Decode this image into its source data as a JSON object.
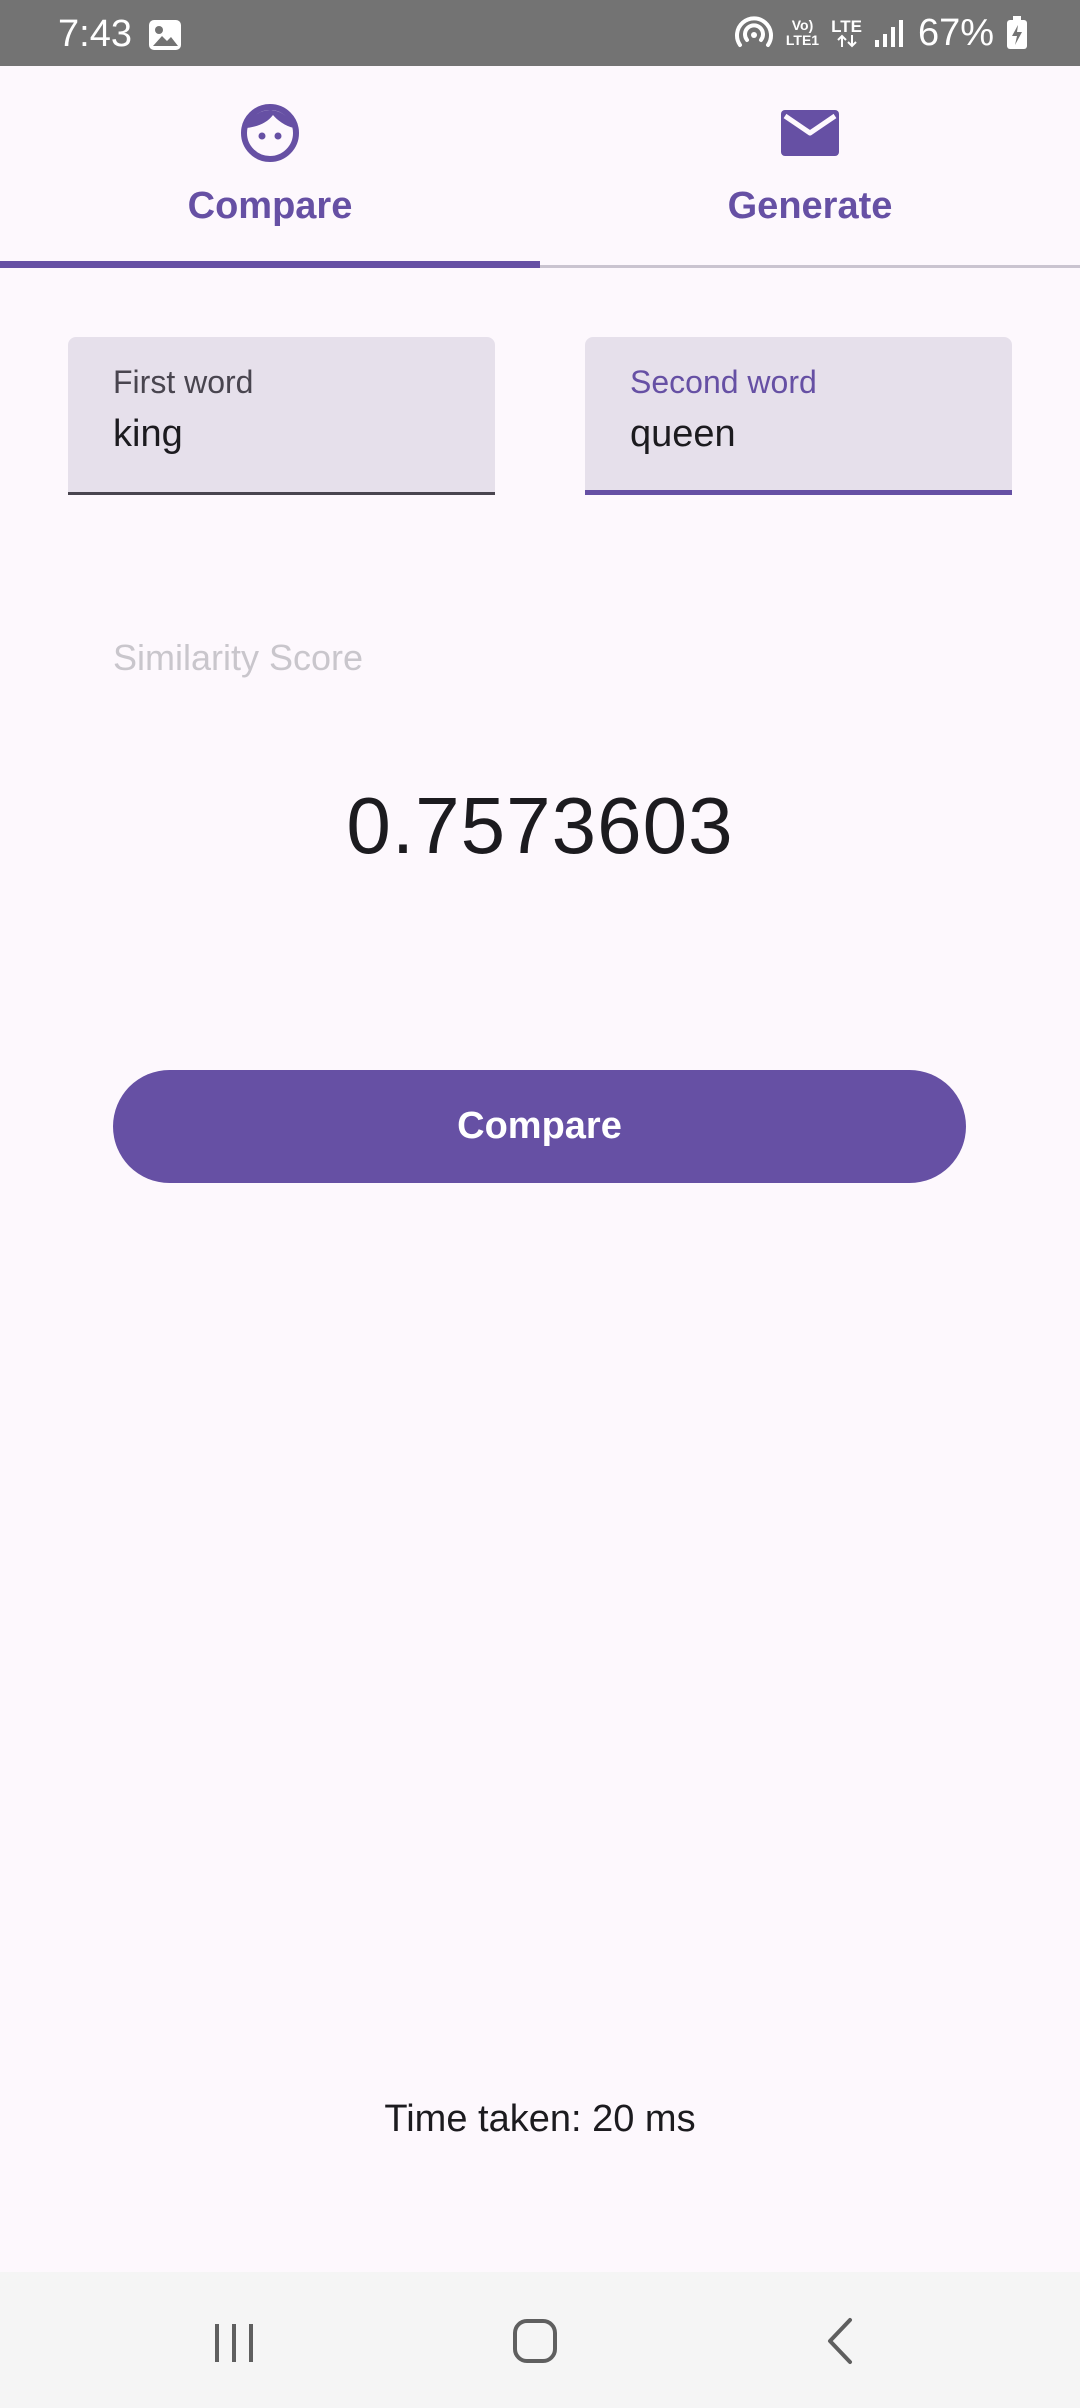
{
  "status_bar": {
    "time": "7:43",
    "network_top": "Vo)",
    "network_bottom": "LTE1",
    "lte_label": "LTE",
    "battery_percent": "67%",
    "icons": [
      "image-icon",
      "hotspot-icon",
      "volte-icon",
      "lte-icon",
      "signal-icon",
      "battery-charging-icon"
    ]
  },
  "tabs": [
    {
      "label": "Compare",
      "icon": "face-icon",
      "selected": true
    },
    {
      "label": "Generate",
      "icon": "mail-icon",
      "selected": false
    }
  ],
  "fields": {
    "first": {
      "label": "First word",
      "value": "king"
    },
    "second": {
      "label": "Second word",
      "value": "queen"
    }
  },
  "similarity": {
    "label": "Similarity Score",
    "score": "0.7573603"
  },
  "compare_button": {
    "label": "Compare"
  },
  "time_taken": "Time taken: 20 ms",
  "nav_bar": {
    "icons": [
      "recents-icon",
      "home-icon",
      "back-icon"
    ]
  },
  "colors": {
    "accent": "#6650a4",
    "background": "#fdf8fd",
    "field_background": "#e6e0eb",
    "status_bar": "#737373",
    "nav_bar": "#f5f5f5"
  }
}
